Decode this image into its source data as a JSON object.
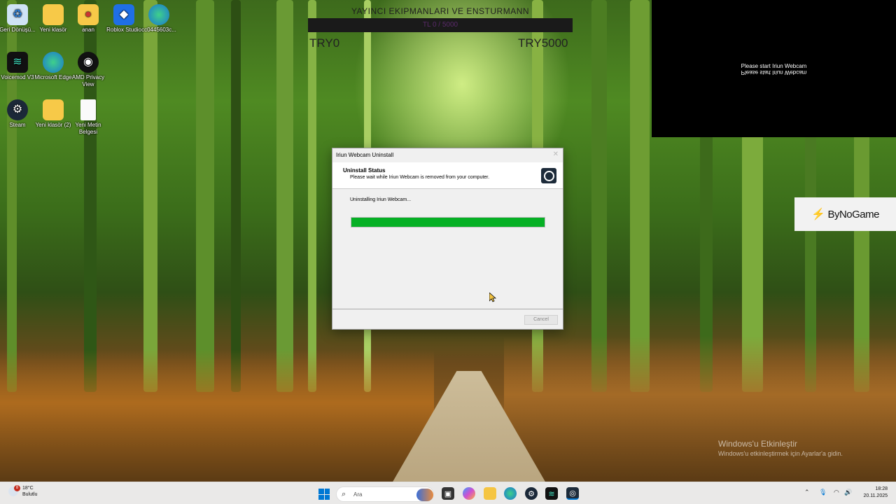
{
  "desktop": {
    "icons": [
      {
        "label": "Geri Dönüşü...",
        "icon": "recycle-bin-icon"
      },
      {
        "label": "Yeni klasör",
        "icon": "folder-icon"
      },
      {
        "label": "anan",
        "icon": "folder-icon"
      },
      {
        "label": "Roblox Studio",
        "icon": "roblox-studio-icon"
      },
      {
        "label": "cc0445603c...",
        "icon": "edge-icon"
      },
      {
        "label": "Voicemod V3",
        "icon": "voicemod-icon"
      },
      {
        "label": "Microsoft Edge",
        "icon": "edge-icon"
      },
      {
        "label": "AMD Privacy View",
        "icon": "amd-eye-icon"
      },
      {
        "label": "Steam",
        "icon": "steam-icon"
      },
      {
        "label": "Yeni klasör (2)",
        "icon": "folder-icon"
      },
      {
        "label": "Yeni Metin Belgesi",
        "icon": "text-file-icon"
      }
    ]
  },
  "overlay": {
    "title": "YAYINCI EKIPMANLARI VE ENSTURMANN",
    "bar_text": "TL 0 / 5000",
    "min_label": "TRY0",
    "max_label": "TRY5000"
  },
  "webcam_preview": {
    "message": "Please start Iriun Webcam",
    "message_mirrored": "Please start Iriun Webcam"
  },
  "bynogame": {
    "label": "ByNoGame"
  },
  "dialog": {
    "title": "Iriun Webcam Uninstall",
    "close": "✕",
    "header_title": "Uninstall Status",
    "header_subtitle": "Please wait while Iriun Webcam is removed from your computer.",
    "status": "Uninstalling Iriun Webcam...",
    "progress": 1.0,
    "cancel_label": "Cancel",
    "accent": "#06b025"
  },
  "watermark": {
    "line1": "Windows'u Etkinleştir",
    "line2": "Windows'u etkinleştirmek için Ayarlar'a gidin."
  },
  "taskbar": {
    "weather_temp": "18°C",
    "weather_desc": "Bulutlu",
    "weather_badge": "8",
    "search_placeholder": "Ara",
    "time": "18:28",
    "date": "20.11.2025",
    "apps": [
      "start-icon",
      "search-icon",
      "game-icon",
      "file-explorer-icon",
      "copilot-icon",
      "folder-icon",
      "edge-icon",
      "steam-icon",
      "voicemod-icon",
      "iriun-icon"
    ]
  }
}
